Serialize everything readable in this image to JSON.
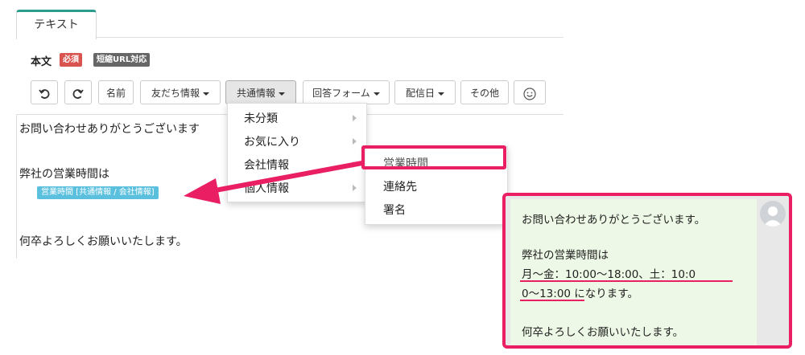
{
  "editor": {
    "tab_label": "テキスト",
    "body_label": "本文",
    "badge_required": "必須",
    "badge_short_url": "短縮URL対応"
  },
  "toolbar": {
    "name": "名前",
    "friend_info": "友だち情報",
    "common_info": "共通情報",
    "answer_form": "回答フォーム",
    "delivery_date": "配信日",
    "other": "その他"
  },
  "textarea": {
    "line1": "お問い合わせありがとうございます",
    "line2": "弊社の営業時間は",
    "tag": "営業時間 [共通情報 / 会社情報]",
    "line3": "何卒よろしくお願いいたします。"
  },
  "menu": {
    "items": [
      "未分類",
      "お気に入り",
      "会社情報",
      "個人情報"
    ]
  },
  "submenu": {
    "items": [
      "営業時間",
      "連絡先",
      "署名"
    ]
  },
  "preview": {
    "line1": "お問い合わせありがとうございます。",
    "line2": "弊社の営業時間は",
    "line3": "月～金：10:00～18:00、土：10:0",
    "line4a": "0～13:00",
    "line4b": " になります。",
    "line5": "何卒よろしくお願いいたします。"
  },
  "colors": {
    "accent_pink": "#e91e63",
    "tab_accent": "#2a9d8f",
    "tag_blue": "#5bc0de",
    "bubble_green": "#eef8e6"
  },
  "icons": [
    "undo-icon",
    "redo-icon",
    "smiley-icon",
    "chevron-right-icon",
    "user-avatar-icon",
    "arrow-icon"
  ]
}
